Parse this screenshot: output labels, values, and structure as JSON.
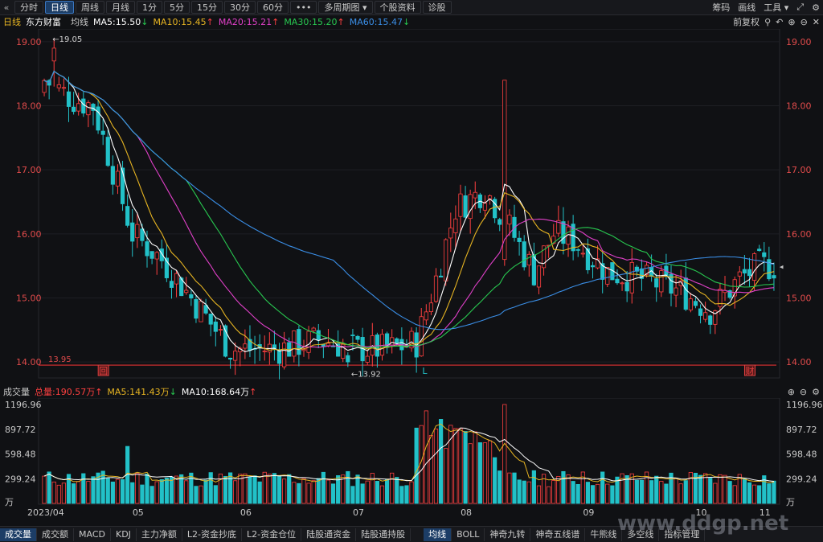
{
  "toolbar": {
    "nav_icon": "«",
    "tabs": [
      "分时",
      "日线",
      "周线",
      "月线",
      "1分",
      "5分",
      "15分",
      "30分",
      "60分",
      "•••",
      "多周期图 ▾",
      "个股资料",
      "诊股"
    ],
    "right": [
      "筹码",
      "画线",
      "工具 ▾"
    ]
  },
  "main_legend": {
    "period": "日线",
    "name": "东方财富",
    "ma_label": "均线",
    "ma5": "MA5:15.50",
    "ma10": "MA10:15.45",
    "ma20": "MA20:15.21",
    "ma30": "MA30:15.20",
    "ma60": "MA60:15.47",
    "fq": "前复权"
  },
  "vol_legend": {
    "title": "成交量",
    "total": "总量:190.57万",
    "ma5": "MA5:141.43万",
    "ma10": "MA10:168.64万"
  },
  "colors": {
    "up": "#ff4040",
    "down": "#22c1c8",
    "ma5": "#ffffff",
    "ma10": "#e6b422",
    "ma20": "#e040c8",
    "ma30": "#28c850",
    "ma60": "#3a8ee6",
    "support": "#e03030"
  },
  "chart_data": [
    {
      "type": "candlestick",
      "title": "东方财富 日线",
      "ylim": [
        13.8,
        19.2
      ],
      "y_ticks": [
        "19.00",
        "18.00",
        "17.00",
        "16.00",
        "15.00",
        "14.00"
      ],
      "x_ticks": [
        "2023/04",
        "05",
        "06",
        "07",
        "08",
        "09",
        "10",
        "11"
      ],
      "annotations": [
        "←19.05",
        "←13.92",
        "13.95"
      ],
      "markers": [
        "回",
        "L",
        "财"
      ],
      "series": [
        {
          "name": "MA5",
          "last": 15.5
        },
        {
          "name": "MA10",
          "last": 15.45
        },
        {
          "name": "MA20",
          "last": 15.21
        },
        {
          "name": "MA30",
          "last": 15.2
        },
        {
          "name": "MA60",
          "last": 15.47
        }
      ],
      "high": 19.05,
      "low": 13.92,
      "support_line": 13.95
    },
    {
      "type": "bar",
      "title": "成交量",
      "y_ticks": [
        "1196.96",
        "897.72",
        "598.48",
        "299.24",
        "万"
      ],
      "ylim": [
        0,
        1196.96
      ],
      "series": [
        {
          "name": "MA5",
          "last": 141.43
        },
        {
          "name": "MA10",
          "last": 168.64
        }
      ],
      "last_volume": 190.57
    }
  ],
  "bottom_tabs_left": [
    "成交量",
    "成交额",
    "MACD",
    "KDJ",
    "主力净额",
    "L2-资金抄底",
    "L2-资金仓位",
    "陆股通资金",
    "陆股通持股"
  ],
  "bottom_tabs_right": [
    "均线",
    "BOLL",
    "神奇九转",
    "神奇五线谱",
    "牛熊线",
    "多空线",
    "指标管理"
  ],
  "watermark": "www.ddgp.net"
}
